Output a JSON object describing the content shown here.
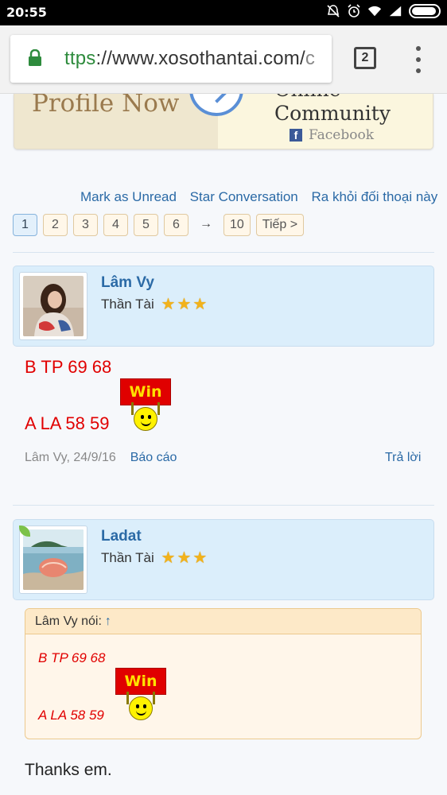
{
  "status_bar": {
    "time": "20:55",
    "icons": [
      "mute-icon",
      "alarm-icon",
      "wifi-icon",
      "signal-icon",
      "battery-icon"
    ]
  },
  "browser": {
    "url_scheme": "ttps",
    "url_rest": "://www.xosothantai.com/",
    "url_tail": "c",
    "tab_count": "2"
  },
  "banner": {
    "left_text": "Profile Now",
    "right_line1": "Online",
    "right_line2": "Community",
    "facebook_label": "Facebook"
  },
  "thread_actions": {
    "mark_unread": "Mark as Unread",
    "star": "Star Conversation",
    "leave": "Ra khỏi đối thoại này"
  },
  "pagination": {
    "pages": [
      "1",
      "2",
      "3",
      "4",
      "5",
      "6"
    ],
    "current": "1",
    "arrow": "→",
    "last": "10",
    "next": "Tiếp >"
  },
  "posts": [
    {
      "username": "Lâm Vy",
      "user_title": "Thần Tài",
      "stars": 3,
      "lines": [
        "B TP 69 68",
        "A LA 58 59"
      ],
      "win_label": "Win",
      "meta_author_date": "Lâm Vy, 24/9/16",
      "report": "Báo cáo",
      "reply": "Trả lời"
    },
    {
      "username": "Ladat",
      "user_title": "Thần Tài",
      "stars": 3,
      "quote_header": "Lâm Vy nói:",
      "quote_arrow": "↑",
      "quote_lines": [
        "B TP 69 68",
        "A LA 58 59"
      ],
      "win_label": "Win",
      "message": "Thanks em."
    }
  ],
  "colors": {
    "link": "#2b6aa6",
    "red_text": "#e10000",
    "user_box_bg": "#dbeefb",
    "quote_bg": "#fff6ea"
  }
}
